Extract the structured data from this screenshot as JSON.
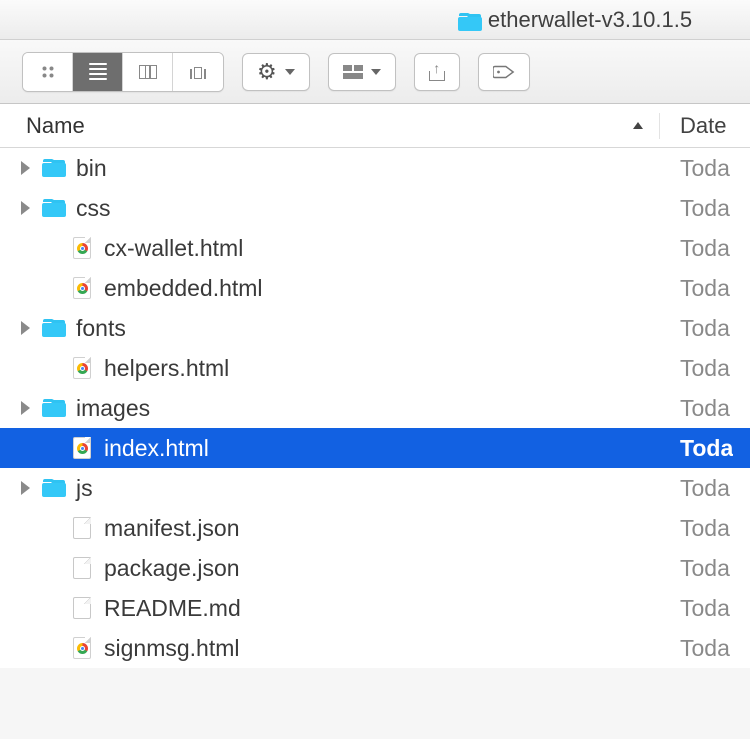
{
  "window": {
    "title": "etherwallet-v3.10.1.5"
  },
  "columns": {
    "name": "Name",
    "date": "Date"
  },
  "rows": [
    {
      "name": "bin",
      "type": "folder",
      "expandable": true,
      "date": "Toda",
      "selected": false,
      "indent": 0
    },
    {
      "name": "css",
      "type": "folder",
      "expandable": true,
      "date": "Toda",
      "selected": false,
      "indent": 0
    },
    {
      "name": "cx-wallet.html",
      "type": "html",
      "expandable": false,
      "date": "Toda",
      "selected": false,
      "indent": 1
    },
    {
      "name": "embedded.html",
      "type": "html",
      "expandable": false,
      "date": "Toda",
      "selected": false,
      "indent": 1
    },
    {
      "name": "fonts",
      "type": "folder",
      "expandable": true,
      "date": "Toda",
      "selected": false,
      "indent": 0
    },
    {
      "name": "helpers.html",
      "type": "html",
      "expandable": false,
      "date": "Toda",
      "selected": false,
      "indent": 1
    },
    {
      "name": "images",
      "type": "folder",
      "expandable": true,
      "date": "Toda",
      "selected": false,
      "indent": 0
    },
    {
      "name": "index.html",
      "type": "html",
      "expandable": false,
      "date": "Toda",
      "selected": true,
      "indent": 1
    },
    {
      "name": "js",
      "type": "folder",
      "expandable": true,
      "date": "Toda",
      "selected": false,
      "indent": 0
    },
    {
      "name": "manifest.json",
      "type": "file",
      "expandable": false,
      "date": "Toda",
      "selected": false,
      "indent": 1
    },
    {
      "name": "package.json",
      "type": "file",
      "expandable": false,
      "date": "Toda",
      "selected": false,
      "indent": 1
    },
    {
      "name": "README.md",
      "type": "file",
      "expandable": false,
      "date": "Toda",
      "selected": false,
      "indent": 1
    },
    {
      "name": "signmsg.html",
      "type": "html",
      "expandable": false,
      "date": "Toda",
      "selected": false,
      "indent": 1
    }
  ]
}
